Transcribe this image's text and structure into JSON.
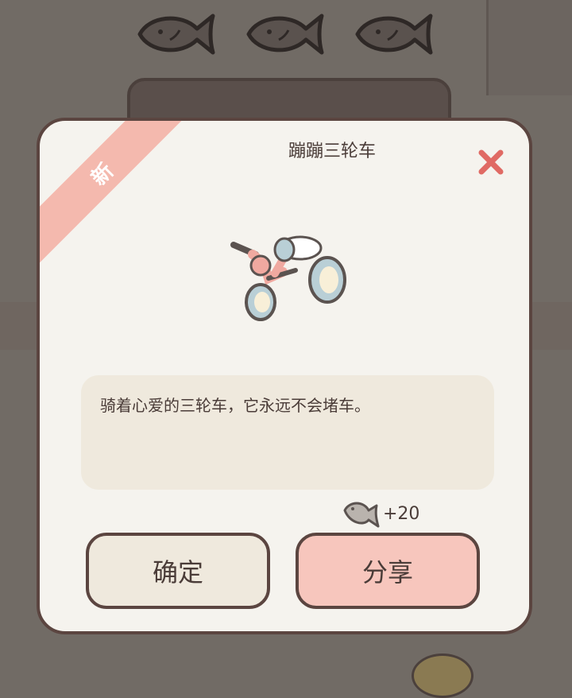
{
  "top_fish_icons": [
    "fish-icon",
    "fish-icon",
    "fish-icon"
  ],
  "dialog": {
    "badge": "新",
    "title": "蹦蹦三轮车",
    "close_icon": "close-icon",
    "item_icon": "tricycle-icon",
    "description": "骑着心爱的三轮车，它永远不会堵车。",
    "reward": {
      "icon": "fish-icon",
      "amount": "+20"
    },
    "buttons": {
      "confirm": "确定",
      "share": "分享"
    }
  },
  "colors": {
    "accent_pink": "#f4b9ae",
    "close_red": "#e06a64",
    "panel_bg": "#f5f3ee",
    "border": "#5b4540"
  }
}
